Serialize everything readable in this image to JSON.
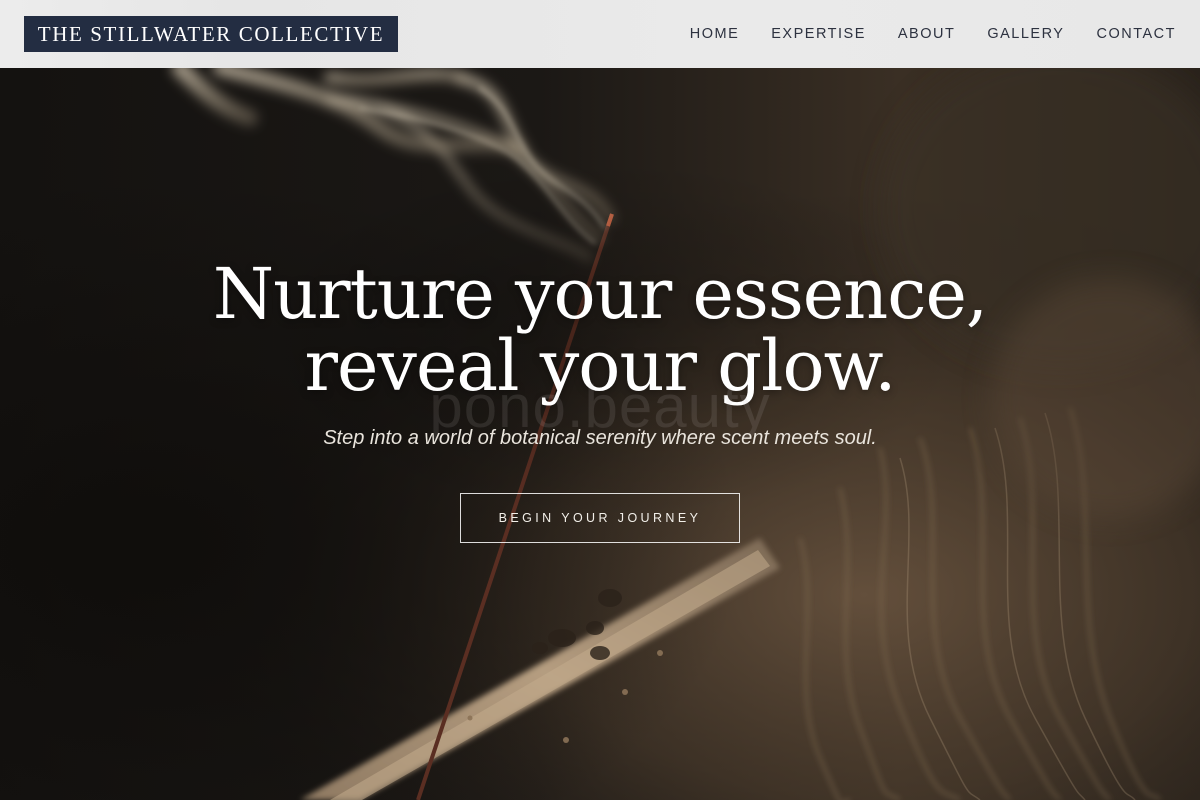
{
  "header": {
    "brand": "THE STILLWATER COLLECTIVE",
    "nav": [
      {
        "label": "HOME"
      },
      {
        "label": "EXPERTISE"
      },
      {
        "label": "ABOUT"
      },
      {
        "label": "GALLERY"
      },
      {
        "label": "CONTACT"
      }
    ]
  },
  "hero": {
    "title_line1": "Nurture your essence,",
    "title_line2": "reveal your glow.",
    "watermark": "pono.beauty",
    "subtitle": "Step into a world of botanical serenity where scent meets soul.",
    "cta_label": "BEGIN YOUR JOURNEY",
    "background_description_icon": "incense-smoke-image"
  },
  "colors": {
    "brand_bg": "#232d42",
    "header_bg": "#e8e8e8",
    "nav_text": "#2d3240",
    "hero_text": "#ffffff"
  }
}
